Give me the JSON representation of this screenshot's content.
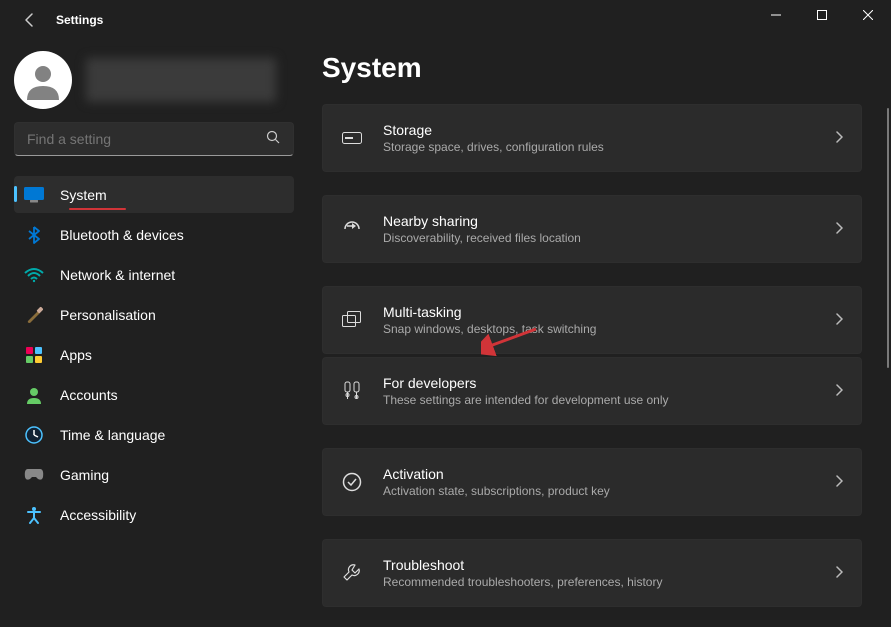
{
  "window": {
    "title": "Settings"
  },
  "sidebar": {
    "search_placeholder": "Find a setting",
    "items": [
      {
        "icon": "monitor",
        "label": "System",
        "active": true
      },
      {
        "icon": "bluetooth",
        "label": "Bluetooth & devices",
        "active": false
      },
      {
        "icon": "wifi",
        "label": "Network & internet",
        "active": false
      },
      {
        "icon": "brush",
        "label": "Personalisation",
        "active": false
      },
      {
        "icon": "apps",
        "label": "Apps",
        "active": false
      },
      {
        "icon": "account",
        "label": "Accounts",
        "active": false
      },
      {
        "icon": "time",
        "label": "Time & language",
        "active": false
      },
      {
        "icon": "gaming",
        "label": "Gaming",
        "active": false
      },
      {
        "icon": "access",
        "label": "Accessibility",
        "active": false
      }
    ]
  },
  "main": {
    "heading": "System",
    "cards": [
      {
        "icon": "storage",
        "title": "Storage",
        "subtitle": "Storage space, drives, configuration rules"
      },
      {
        "icon": "share",
        "title": "Nearby sharing",
        "subtitle": "Discoverability, received files location"
      },
      {
        "icon": "multitask",
        "title": "Multi-tasking",
        "subtitle": "Snap windows, desktops, task switching"
      },
      {
        "icon": "developer",
        "title": "For developers",
        "subtitle": "These settings are intended for development use only"
      },
      {
        "icon": "activation",
        "title": "Activation",
        "subtitle": "Activation state, subscriptions, product key"
      },
      {
        "icon": "troubleshoot",
        "title": "Troubleshoot",
        "subtitle": "Recommended troubleshooters, preferences, history"
      }
    ],
    "groups": [
      [
        0
      ],
      [
        1
      ],
      [
        2,
        3
      ],
      [
        4
      ],
      [
        5
      ]
    ]
  },
  "annotation": {
    "target_card_index": 3
  }
}
